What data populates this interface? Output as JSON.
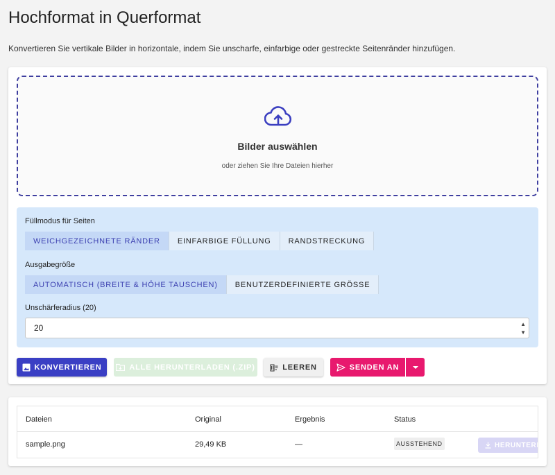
{
  "page": {
    "title": "Hochformat in Querformat",
    "subtitle": "Konvertieren Sie vertikale Bilder in horizontale, indem Sie unscharfe, einfarbige oder gestreckte Seitenränder hinzufügen."
  },
  "dropzone": {
    "icon": "cloud-upload-icon",
    "title": "Bilder auswählen",
    "hint": "oder ziehen Sie Ihre Dateien hierher"
  },
  "options": {
    "fill_mode": {
      "label": "Füllmodus für Seiten",
      "items": [
        "Weichgezeichnete Ränder",
        "Einfarbige Füllung",
        "Randstreckung"
      ],
      "selected": "Weichgezeichnete Ränder"
    },
    "output_size": {
      "label": "Ausgabegröße",
      "items": [
        "Automatisch (Breite & Höhe tauschen)",
        "Benutzerdefinierte Grösse"
      ],
      "selected": "Automatisch (Breite & Höhe tauschen)"
    },
    "blur_radius": {
      "label": "Unschärferadius (20)",
      "value": "20"
    }
  },
  "actions": {
    "convert": "Konvertieren",
    "download_all": "Alle herunterladen (.zip)",
    "clear": "Leeren",
    "send_to": "Senden an"
  },
  "table": {
    "headers": [
      "Dateien",
      "Original",
      "Ergebnis",
      "Status"
    ],
    "rows": [
      {
        "file": "sample.png",
        "original": "29,49 KB",
        "result": "—",
        "status": "AUSSTEHEND",
        "download": "Herunterla"
      }
    ]
  },
  "colors": {
    "primary": "#3a3fc4",
    "accent": "#e8196e",
    "options_bg": "#d6e8fb",
    "dropzone_border": "#3f3fa0"
  }
}
